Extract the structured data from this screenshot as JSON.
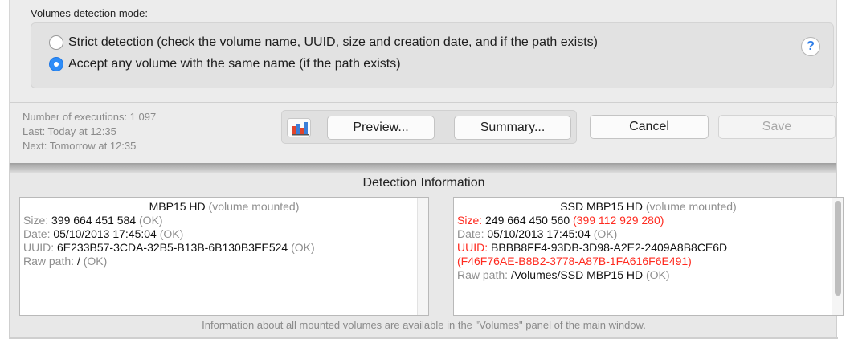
{
  "mode": {
    "title": "Volumes detection mode:",
    "options": [
      {
        "label": "Strict detection (check the volume name, UUID, size and creation date, and if the path exists)",
        "selected": false
      },
      {
        "label": "Accept any volume with the same name (if the path exists)",
        "selected": true
      }
    ],
    "help_label": "?"
  },
  "stats": {
    "executions": "Number of executions: 1 097",
    "last": "Last: Today at 12:35",
    "next": "Next: Tomorrow at 12:35"
  },
  "buttons": {
    "chart_icon": "bar-chart-icon",
    "preview": "Preview...",
    "summary": "Summary...",
    "cancel": "Cancel",
    "save": "Save"
  },
  "detection": {
    "title": "Detection Information",
    "left": {
      "name": "MBP15 HD",
      "status": "(volume mounted)",
      "size_label": "Size:",
      "size_value": "399 664 451 584",
      "size_note": "(OK)",
      "date_label": "Date:",
      "date_value": "05/10/2013 17:45:04",
      "date_note": "(OK)",
      "uuid_label": "UUID:",
      "uuid_value": "6E233B57-3CDA-32B5-B13B-6B130B3FE524",
      "uuid_note": "(OK)",
      "path_label": "Raw path:",
      "path_value": "/",
      "path_note": "(OK)"
    },
    "right": {
      "name": "SSD MBP15 HD",
      "status": "(volume mounted)",
      "size_label": "Size:",
      "size_value": "249 664 450 560",
      "size_note": "(399 112 929 280)",
      "date_label": "Date:",
      "date_value": "05/10/2013 17:45:04",
      "date_note": "(OK)",
      "uuid_label": "UUID:",
      "uuid_value": "BBBB8FF4-93DB-3D98-A2E2-2409A8B8CE6D",
      "uuid_note": "(F46F76AE-B8B2-3778-A87B-1FA616F6E491)",
      "path_label": "Raw path:",
      "path_value": "/Volumes/SSD MBP15 HD",
      "path_note": "(OK)"
    },
    "footer": "Information about all mounted volumes are available in the \"Volumes\" panel of the main window."
  },
  "colors": {
    "accent": "#2d8cf7",
    "error": "#ff2a1f",
    "muted": "#8e8e8e"
  }
}
